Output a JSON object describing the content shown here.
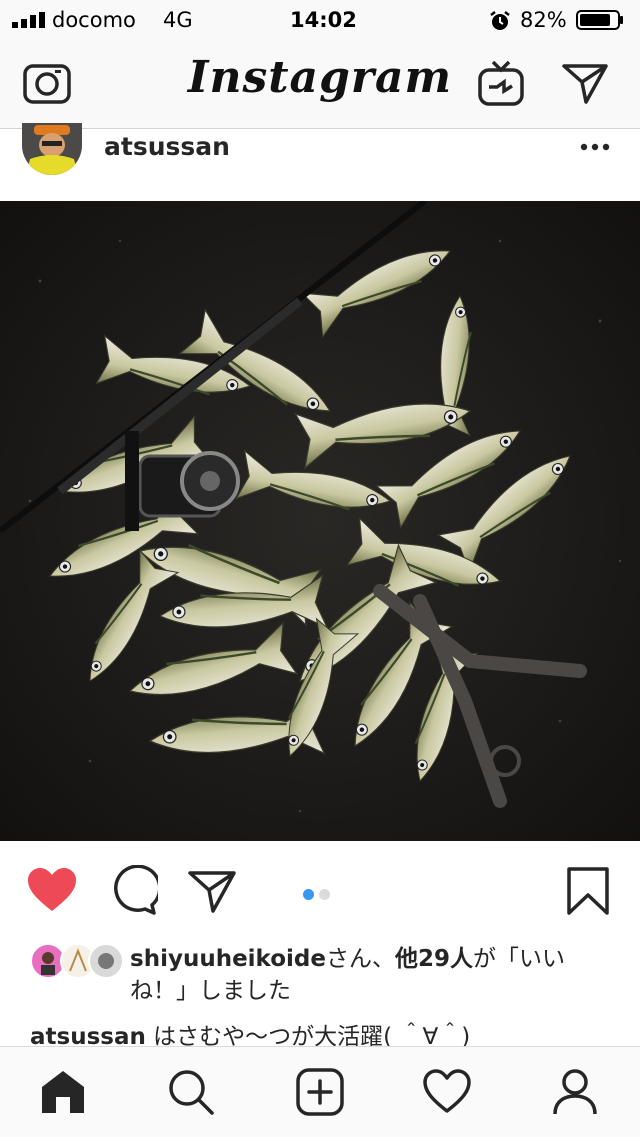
{
  "status_bar": {
    "carrier": "docomo",
    "network": "4G",
    "time": "14:02",
    "battery_percent": "82%",
    "battery_level": 0.82
  },
  "nav": {
    "logo": "Instagram",
    "icons": [
      "camera-icon",
      "igtv-icon",
      "direct-message-icon"
    ]
  },
  "post": {
    "username": "atsussan",
    "photo_subject": "photo-fish-catch",
    "carousel_pages": 2,
    "carousel_active": 1,
    "likes": {
      "first_user": "shiyuuheikoide",
      "text_san": "さん、",
      "others": "他29人",
      "text_suffix": "が「いいね！」しました"
    },
    "caption": {
      "user": "atsussan",
      "text": "はさむや〜つが大活躍( ＾∀＾)"
    }
  },
  "colors": {
    "like_red": "#ed4956",
    "dot_active": "#3897f0",
    "dot_inactive": "#dbdbdb"
  },
  "tabs": [
    "home-icon",
    "search-icon",
    "add-post-icon",
    "activity-heart-icon",
    "profile-icon"
  ]
}
